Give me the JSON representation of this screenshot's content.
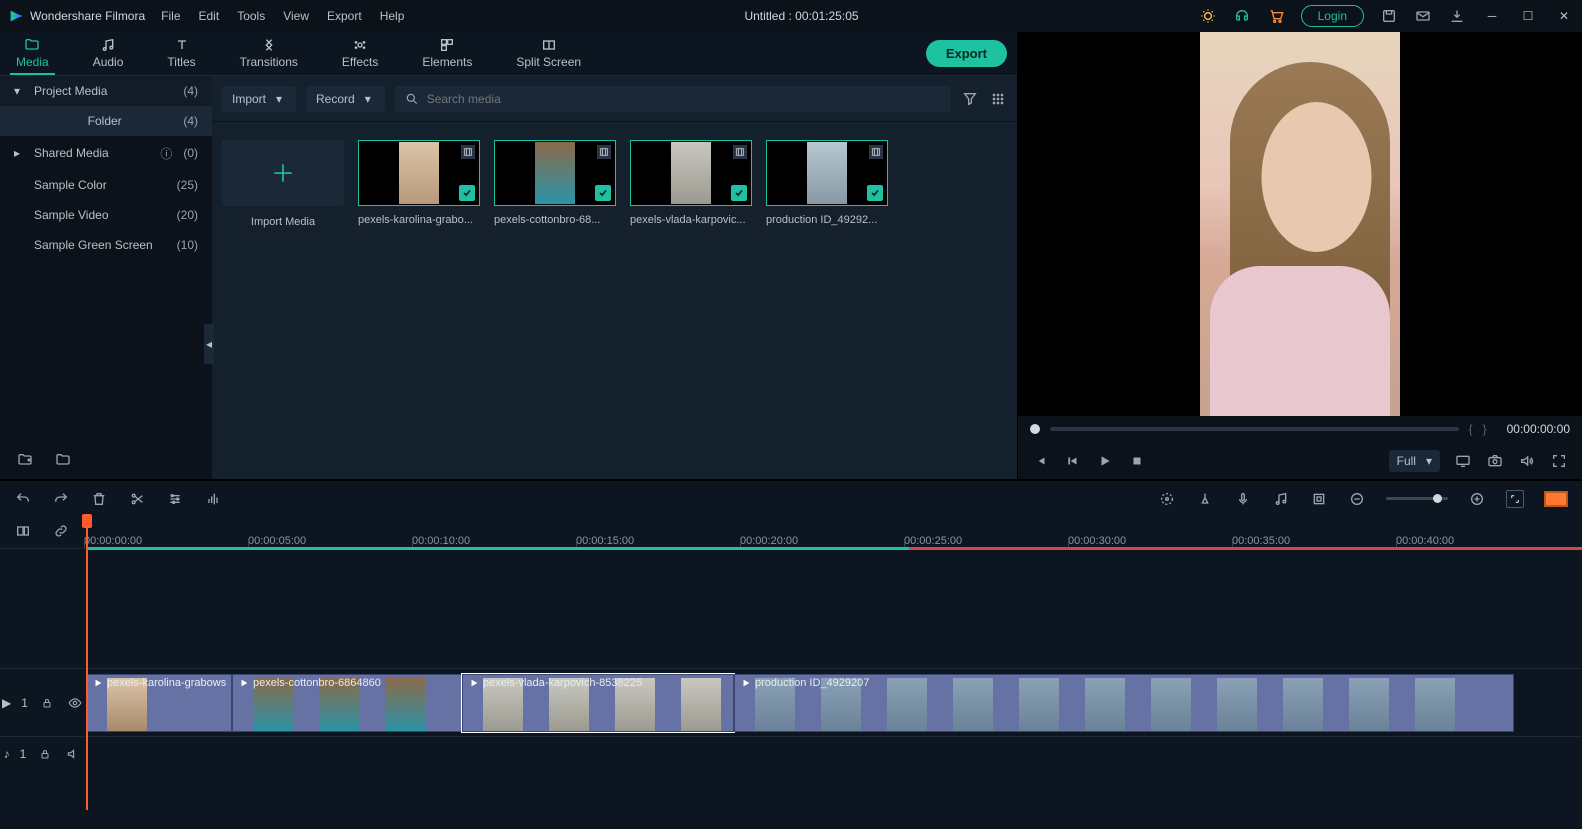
{
  "app": {
    "name": "Wondershare Filmora",
    "title": "Untitled : 00:01:25:05"
  },
  "menu": {
    "file": "File",
    "edit": "Edit",
    "tools": "Tools",
    "view": "View",
    "export": "Export",
    "help": "Help"
  },
  "titlebar": {
    "login": "Login"
  },
  "tabs": {
    "media": "Media",
    "audio": "Audio",
    "titles": "Titles",
    "transitions": "Transitions",
    "effects": "Effects",
    "elements": "Elements",
    "splitscreen": "Split Screen",
    "export": "Export"
  },
  "sidebar": {
    "project_media": {
      "label": "Project Media",
      "count": "(4)"
    },
    "folder": {
      "label": "Folder",
      "count": "(4)"
    },
    "shared_media": {
      "label": "Shared Media",
      "count": "(0)"
    },
    "sample_color": {
      "label": "Sample Color",
      "count": "(25)"
    },
    "sample_video": {
      "label": "Sample Video",
      "count": "(20)"
    },
    "sample_green": {
      "label": "Sample Green Screen",
      "count": "(10)"
    }
  },
  "toolbar": {
    "import": "Import",
    "record": "Record",
    "search_placeholder": "Search media"
  },
  "media": {
    "import": "Import Media",
    "clip1": "pexels-karolina-grabo...",
    "clip2": "pexels-cottonbro-68...",
    "clip3": "pexels-vlada-karpovic...",
    "clip4": "production ID_49292..."
  },
  "preview": {
    "timecode": "00:00:00:00",
    "brace_l": "{",
    "brace_r": "}",
    "quality": "Full"
  },
  "timeline": {
    "marks": [
      "00:00:00:00",
      "00:00:05:00",
      "00:00:10:00",
      "00:00:15:00",
      "00:00:20:00",
      "00:00:25:00",
      "00:00:30:00",
      "00:00:35:00",
      "00:00:40:00"
    ],
    "video_track": "1",
    "audio_track": "1",
    "clips": {
      "c1": "pexels-karolina-grabows",
      "c2": "pexels-cottonbro-6864860",
      "c3": "pexels-vlada-karpovich-8538225",
      "c4": "production ID_4929207"
    }
  }
}
